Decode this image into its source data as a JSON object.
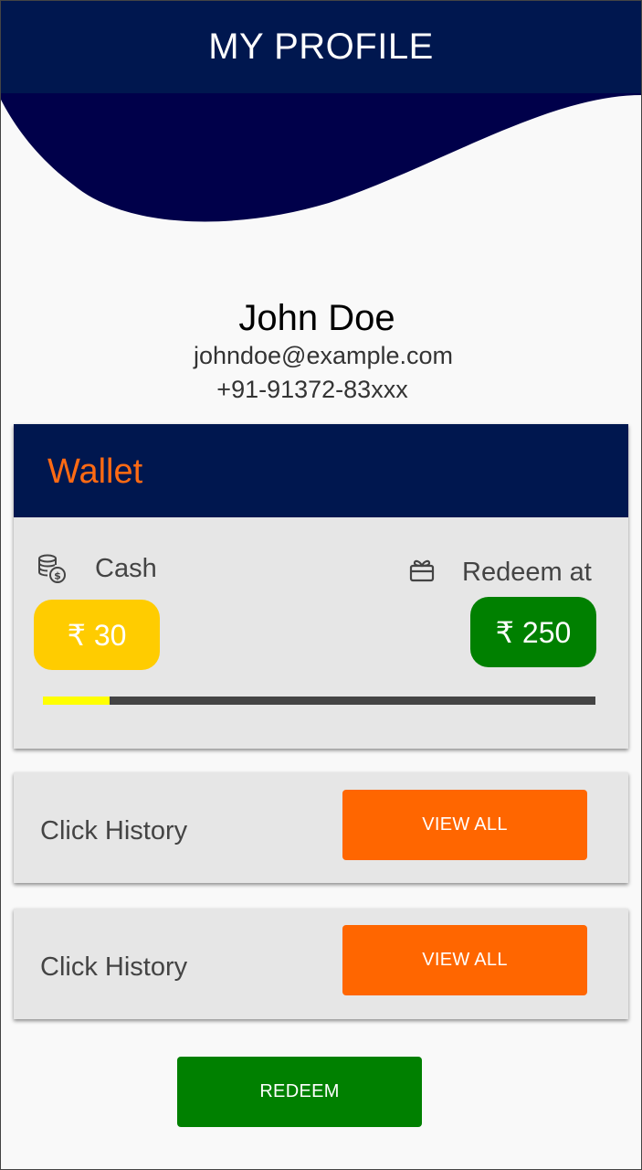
{
  "header": {
    "title": "MY PROFILE"
  },
  "profile": {
    "name": "John Doe",
    "email": "johndoe@example.com",
    "phone": "+91-91372-83xxx"
  },
  "wallet": {
    "title": "Wallet",
    "cash_label": "Cash",
    "cash_icon": "coins-icon",
    "cash_value": "₹ 30",
    "redeem_label": "Redeem at",
    "redeem_icon": "gift-icon",
    "redeem_value": "₹ 250",
    "progress_fraction": 0.12
  },
  "history_cards": [
    {
      "label": "Click History",
      "button": "VIEW ALL"
    },
    {
      "label": "Click History",
      "button": "VIEW ALL"
    }
  ],
  "redeem_button": "REDEEM",
  "colors": {
    "primary_navy": "#00174f",
    "accent_orange": "#ff6600",
    "cash_yellow": "#ffcc00",
    "redeem_green": "#008000",
    "progress_fill": "#ffff00"
  }
}
